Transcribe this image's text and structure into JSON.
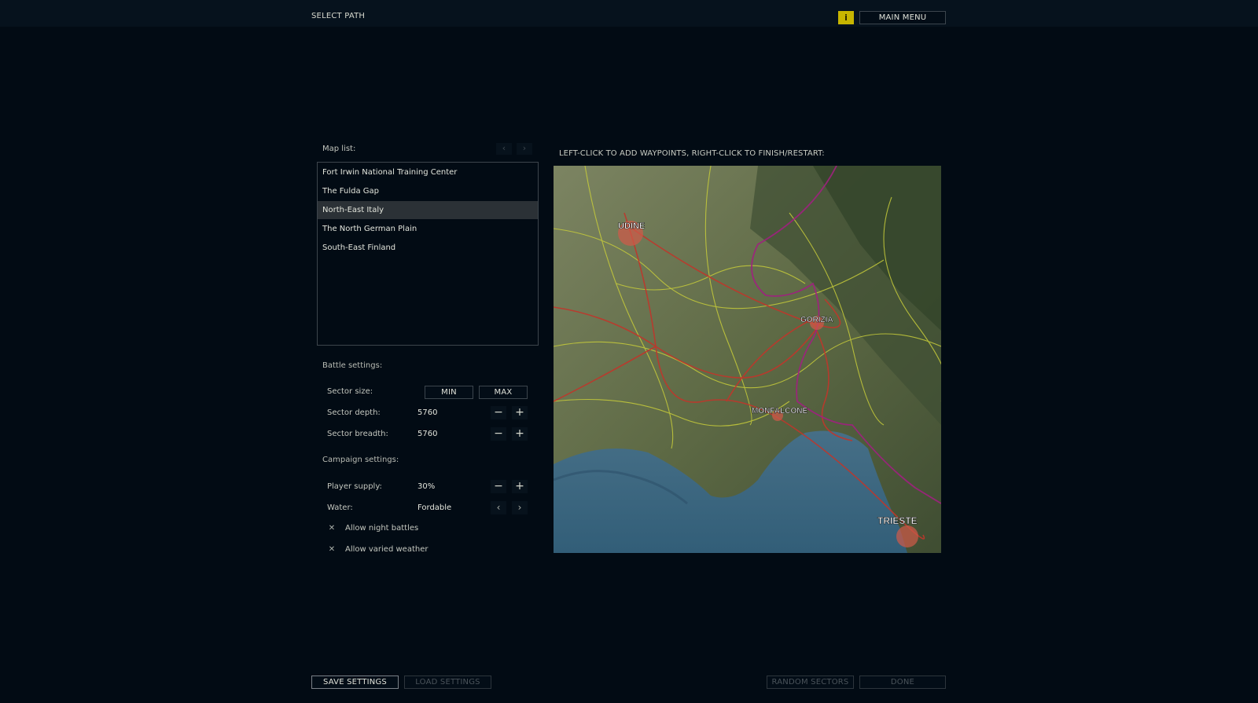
{
  "header": {
    "title": "SELECT PATH",
    "info_label": "i",
    "main_menu_label": "MAIN MENU"
  },
  "map_list": {
    "label": "Map list:",
    "prev_label": "‹",
    "next_label": "›",
    "items": [
      {
        "label": "Fort Irwin National Training Center",
        "selected": false
      },
      {
        "label": "The Fulda Gap",
        "selected": false
      },
      {
        "label": "North-East Italy",
        "selected": true
      },
      {
        "label": "The North German Plain",
        "selected": false
      },
      {
        "label": "South-East Finland",
        "selected": false
      }
    ]
  },
  "battle_settings": {
    "label": "Battle settings:",
    "sector_size_label": "Sector size:",
    "min_label": "MIN",
    "max_label": "MAX",
    "sector_depth_label": "Sector depth:",
    "sector_depth_value": "5760",
    "sector_breadth_label": "Sector breadth:",
    "sector_breadth_value": "5760"
  },
  "campaign_settings": {
    "label": "Campaign settings:",
    "player_supply_label": "Player supply:",
    "player_supply_value": "30%",
    "water_label": "Water:",
    "water_value": "Fordable",
    "night_battles_label": "Allow night battles",
    "night_battles_checked": true,
    "varied_weather_label": "Allow varied weather",
    "varied_weather_checked": true
  },
  "icons": {
    "minus": "−",
    "plus": "+",
    "left": "‹",
    "right": "›",
    "check": "✕"
  },
  "map": {
    "instructions": "LEFT-CLICK TO ADD WAYPOINTS, RIGHT-CLICK TO FINISH/RESTART:",
    "labels": {
      "udine": "UDINE",
      "gorizia": "GORIZIA",
      "monfalcone": "MONFALCONE",
      "trieste": "TRIESTE"
    }
  },
  "footer": {
    "save_settings": "SAVE SETTINGS",
    "load_settings": "LOAD SETTINGS",
    "random_sectors": "RANDOM SECTORS",
    "done": "DONE"
  },
  "colors": {
    "background": "#020b14",
    "accent": "#c7b500",
    "border": "#3c454d",
    "selected": "#2b3136"
  }
}
